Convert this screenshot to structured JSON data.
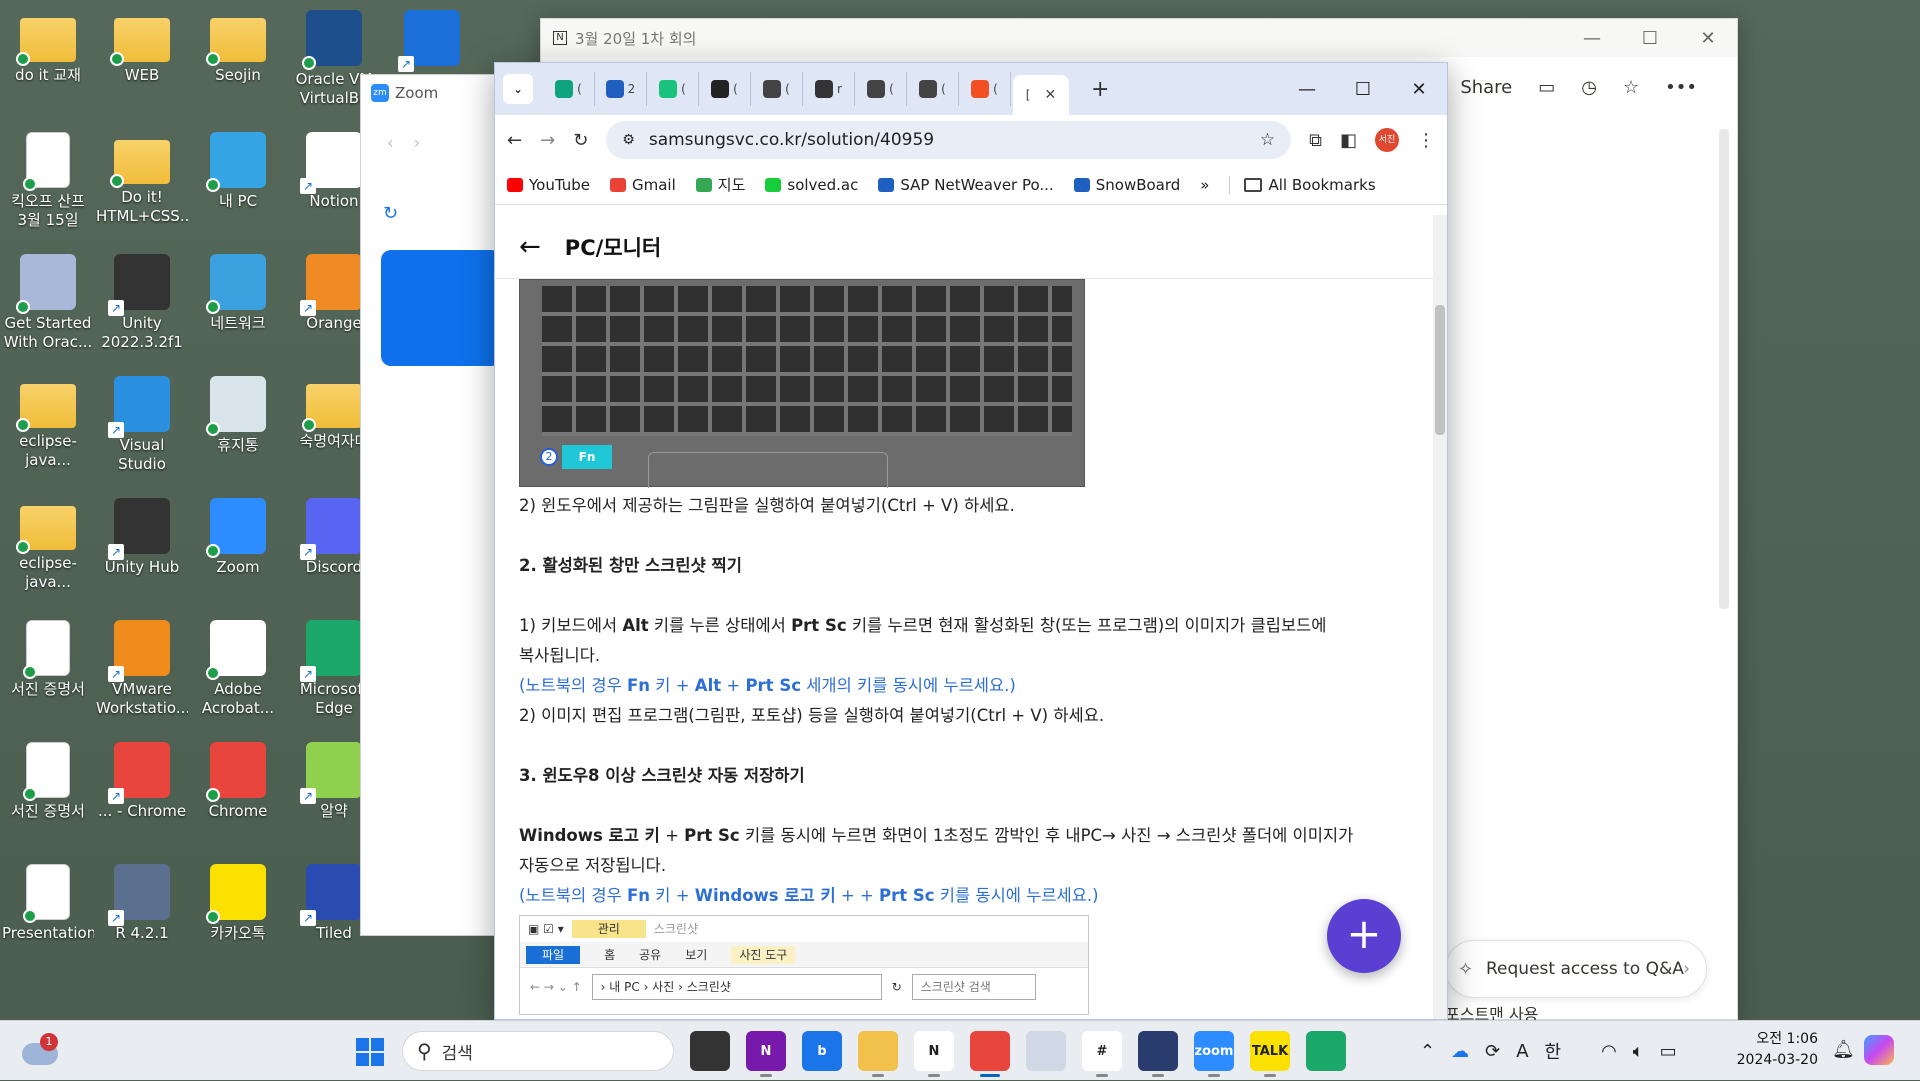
{
  "desktop": {
    "icons": [
      {
        "label": "do it 교재",
        "kind": "folder",
        "color": "#f2c14c"
      },
      {
        "label": "WEB",
        "kind": "folder",
        "color": "#f2c14c"
      },
      {
        "label": "Seojin",
        "kind": "user-folder",
        "color": "#f2c14c"
      },
      {
        "label": "Oracle VM\nVirtualBo",
        "kind": "app",
        "color": "#1d4f8c"
      },
      {
        "label": "",
        "kind": "app",
        "color": "#1b6fd8"
      },
      {
        "label": "킥오프 산프\n3월 15일",
        "kind": "doc",
        "color": "#ffffff"
      },
      {
        "label": "Do it!\nHTML+CSS...",
        "kind": "folder",
        "color": "#f2c14c"
      },
      {
        "label": "내 PC",
        "kind": "app",
        "color": "#34a4e4"
      },
      {
        "label": "Notion",
        "kind": "app",
        "color": "#ffffff"
      },
      {
        "label": "Get Started\nWith Orac...",
        "kind": "app",
        "color": "#a9b8d8"
      },
      {
        "label": "Unity\n2022.3.2f1",
        "kind": "app",
        "color": "#333333"
      },
      {
        "label": "네트워크",
        "kind": "app",
        "color": "#3aa0de"
      },
      {
        "label": "Orange",
        "kind": "app",
        "color": "#f08a24"
      },
      {
        "label": "eclipse-java...",
        "kind": "folder",
        "color": "#f2c14c"
      },
      {
        "label": "Visual Studio\nCode",
        "kind": "app",
        "color": "#2b8fe0"
      },
      {
        "label": "휴지통",
        "kind": "app",
        "color": "#d8e4ea"
      },
      {
        "label": "숙명여자대",
        "kind": "folder",
        "color": "#f2c14c"
      },
      {
        "label": "eclipse-java...",
        "kind": "folder",
        "color": "#f2c14c"
      },
      {
        "label": "Unity Hub",
        "kind": "app",
        "color": "#333333"
      },
      {
        "label": "Zoom",
        "kind": "app",
        "color": "#2d8cff"
      },
      {
        "label": "Discord",
        "kind": "app",
        "color": "#5865f2"
      },
      {
        "label": "서진 증명서",
        "kind": "doc",
        "color": "#ffffff"
      },
      {
        "label": "VMware\nWorkstatio...",
        "kind": "app",
        "color": "#f08c1c"
      },
      {
        "label": "Adobe\nAcrobat...",
        "kind": "app",
        "color": "#ffffff"
      },
      {
        "label": "Microsoft\nEdge",
        "kind": "app",
        "color": "#1da86b"
      },
      {
        "label": "서진 증명서",
        "kind": "doc",
        "color": "#ffffff"
      },
      {
        "label": "... - Chrome",
        "kind": "app",
        "color": "#e8453c"
      },
      {
        "label": "Chrome",
        "kind": "app",
        "color": "#e8453c"
      },
      {
        "label": "알약",
        "kind": "app",
        "color": "#8fd14f"
      },
      {
        "label": "Presentation",
        "kind": "doc",
        "color": "#ffffff"
      },
      {
        "label": "R 4.2.1",
        "kind": "app",
        "color": "#5b6f8f"
      },
      {
        "label": "카카오톡",
        "kind": "app",
        "color": "#fae100"
      },
      {
        "label": "Tiled",
        "kind": "app",
        "color": "#2a4bb0"
      }
    ]
  },
  "notion": {
    "title": "3월 20일 1차 회의",
    "share": "Share",
    "qa_button": "Request access to Q&A",
    "partial_text": "포스트맨 사용"
  },
  "zoom": {
    "title": "Zoom",
    "logo": "zm"
  },
  "chrome": {
    "tabs": [
      {
        "label": "(",
        "fav_color": "#10a37f",
        "icon": "openai-icon"
      },
      {
        "label": "2",
        "fav_color": "#1f5fbf",
        "icon": "snowboard-icon"
      },
      {
        "label": "(",
        "fav_color": "#19c37d",
        "icon": "naver-icon"
      },
      {
        "label": "(",
        "fav_color": "#222222",
        "icon": "c-icon"
      },
      {
        "label": "(",
        "fav_color": "#444444",
        "icon": "clock-icon"
      },
      {
        "label": "r",
        "fav_color": "#333333",
        "icon": "github-icon"
      },
      {
        "label": "(",
        "fav_color": "#444444",
        "icon": "clock-icon"
      },
      {
        "label": "(",
        "fav_color": "#444444",
        "icon": "clock-icon"
      },
      {
        "label": "(",
        "fav_color": "#f25022",
        "icon": "microsoft-icon"
      }
    ],
    "active_tab": {
      "label": "["
    },
    "url": "samsungsvc.co.kr/solution/40959",
    "avatar": "서진",
    "bookmarks": [
      {
        "label": "YouTube",
        "color": "#ff0000"
      },
      {
        "label": "Gmail",
        "color": "#ea4335"
      },
      {
        "label": "지도",
        "color": "#34a853"
      },
      {
        "label": "solved.ac",
        "color": "#17ce3a"
      },
      {
        "label": "SAP NetWeaver Po...",
        "color": "#1f5fbf"
      },
      {
        "label": "SnowBoard",
        "color": "#1f5fbf"
      }
    ],
    "all_bookmarks": "All Bookmarks",
    "page_title": "PC/모니터",
    "fn_key": "Fn",
    "circle_num": "2",
    "lines": {
      "l1": "2) 윈도우에서 제공하는 그림판을 실행하여 붙여넣기(Ctrl + V) 하세요.",
      "h2": "2. 활성화된 창만 스크린샷 찍기",
      "p1a": "1) 키보드에서 ",
      "p1b": "Alt",
      "p1c": " 키를 누른 상태에서 ",
      "p1d": "Prt Sc",
      "p1e": " 키를 누르면 현재 활성화된 창(또는 프로그램)의 이미지가 클립보드에",
      "p1f": "복사됩니다.",
      "note1a": "(노트북의 경우 ",
      "note1b": "Fn",
      "note1c": " 키 + ",
      "note1d": "Alt",
      "note1e": " + ",
      "note1f": "Prt Sc",
      "note1g": " 세개의 키를 동시에 누르세요.)",
      "p2": "2) 이미지 편집 프로그램(그림판, 포토샵) 등을 실행하여 붙여넣기(Ctrl + V) 하세요.",
      "h3": "3. 윈도우8 이상 스크린샷 자동 저장하기",
      "p3a": "Windows 로고 키",
      "p3b": " + ",
      "p3c": "Prt Sc",
      "p3d": " 키를 동시에 누르면 화면이 1초정도 깜박인 후 내PC→ 사진 → 스크린샷 폴더에 이미지가",
      "p3e": "자동으로 저장됩니다.",
      "note2a": "(노트북의 경우 ",
      "note2b": "Fn",
      "note2c": " 키 + ",
      "note2d": "Windows 로고 키",
      "note2e": " + + ",
      "note2f": "Prt Sc",
      "note2g": " 키를 동시에 누르세요.)"
    },
    "explorer": {
      "manage": "관리",
      "screenshot": "스크린샷",
      "file": "파일",
      "home": "홈",
      "share": "공유",
      "view": "보기",
      "photo_tools": "사진 도구",
      "path": "› 내 PC › 사진 › 스크린샷",
      "search": "스크린샷 검색"
    }
  },
  "taskbar": {
    "notification_count": "1",
    "search_placeholder": "검색",
    "apps": [
      {
        "name": "task-view",
        "color": "#333333",
        "label": "",
        "state": ""
      },
      {
        "name": "onenote",
        "color": "#7719aa",
        "label": "N",
        "state": "run"
      },
      {
        "name": "bing",
        "color": "#1b74e8",
        "label": "b",
        "state": ""
      },
      {
        "name": "file-explorer",
        "color": "#f2c14c",
        "label": "",
        "state": "run"
      },
      {
        "name": "notion",
        "color": "#ffffff",
        "label": "N",
        "state": "run"
      },
      {
        "name": "chrome",
        "color": "#e8453c",
        "label": "",
        "state": "act"
      },
      {
        "name": "snipping",
        "color": "#cfd8e4",
        "label": "",
        "state": ""
      },
      {
        "name": "slack",
        "color": "#ffffff",
        "label": "#",
        "state": "run"
      },
      {
        "name": "r-studio",
        "color": "#2a3c6e",
        "label": "",
        "state": "run"
      },
      {
        "name": "zoom",
        "color": "#2d8cff",
        "label": "zoom",
        "state": "run"
      },
      {
        "name": "kakaotalk",
        "color": "#fae100",
        "label": "TALK",
        "state": "run"
      },
      {
        "name": "edge",
        "color": "#1da86b",
        "label": "",
        "state": ""
      }
    ],
    "tray": {
      "ime_a": "A",
      "ime_han": "한"
    },
    "time": "오전 1:06",
    "date": "2024-03-20"
  }
}
